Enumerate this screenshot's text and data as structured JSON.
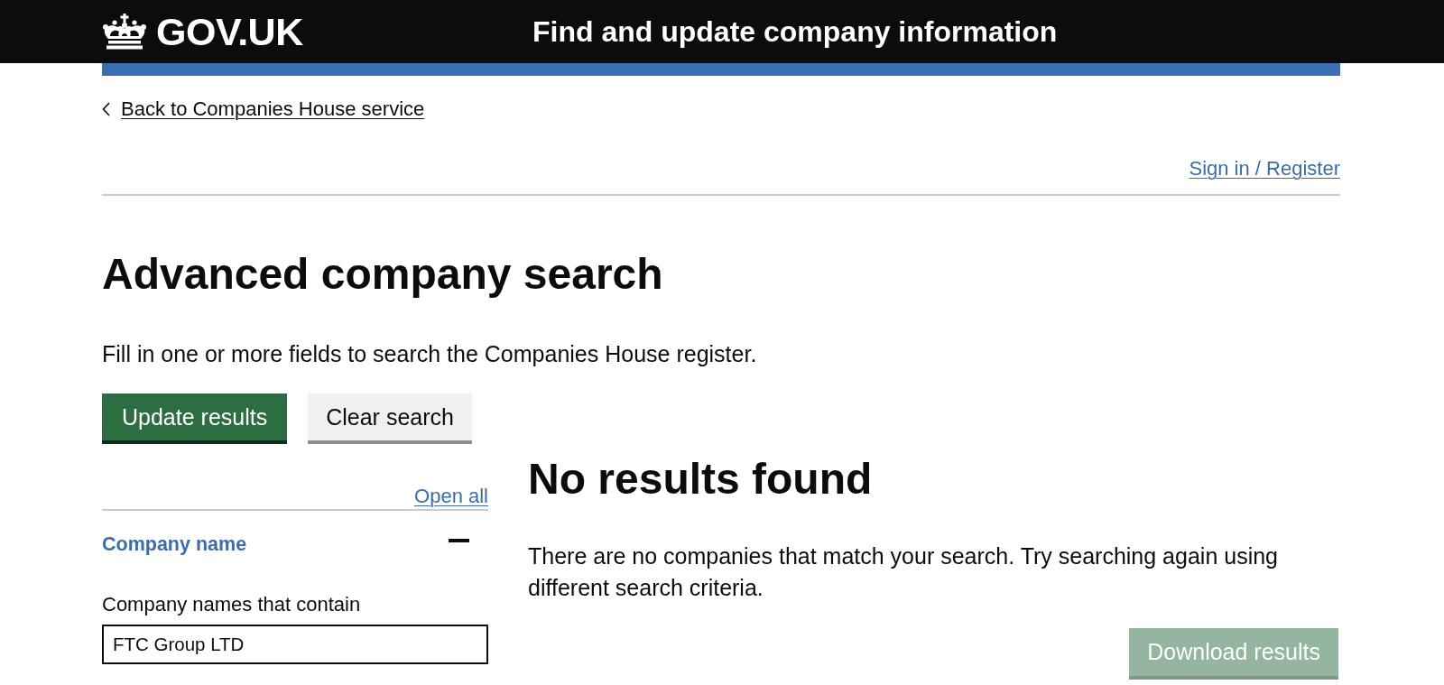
{
  "header": {
    "logo_text": "GOV.UK",
    "service_name": "Find and update company information"
  },
  "back_link": "Back to Companies House service",
  "account_link": "Sign in / Register",
  "page": {
    "title": "Advanced company search",
    "description": "Fill in one or more fields to search the Companies House register."
  },
  "actions": [
    {
      "label": "Update results",
      "kind": "primary"
    },
    {
      "label": "Clear search",
      "kind": "secondary"
    }
  ],
  "filters": {
    "open_all": "Open all",
    "sections": [
      {
        "title": "Company name",
        "expanded": true,
        "fields": [
          {
            "label": "Company names that contain",
            "value": "FTC Group LTD"
          }
        ]
      }
    ]
  },
  "results": {
    "heading": "No results found",
    "message": "There are no companies that match your search. Try searching again using different search criteria.",
    "download_button": {
      "label": "Download results",
      "disabled": true
    }
  }
}
